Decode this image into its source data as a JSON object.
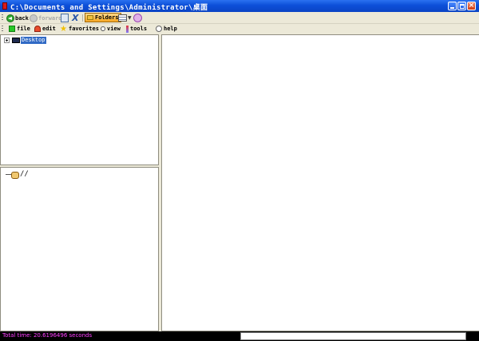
{
  "window": {
    "title": "C:\\Documents and Settings\\Administrator\\桌面"
  },
  "toolbar": {
    "back_label": "back",
    "forward_label": "forward",
    "folders_label": "Folders"
  },
  "menu": {
    "items": [
      {
        "label": "file",
        "icon": "file-icon"
      },
      {
        "label": "edit",
        "icon": "edit-icon"
      },
      {
        "label": "favorites",
        "icon": "star-icon"
      },
      {
        "label": "view",
        "icon": "view-icon"
      },
      {
        "label": "tools",
        "icon": "tools-icon"
      },
      {
        "label": "help",
        "icon": "help-icon"
      }
    ]
  },
  "tree": {
    "root_label": "Desktop",
    "selected": true
  },
  "address": {
    "path": "//"
  },
  "status": {
    "text": "Total time: 20.6196496 seconds",
    "progress": 0
  },
  "colors": {
    "titlebar": "#0d4fd8",
    "selection": "#316ac5",
    "status_text": "#ff40ff"
  }
}
